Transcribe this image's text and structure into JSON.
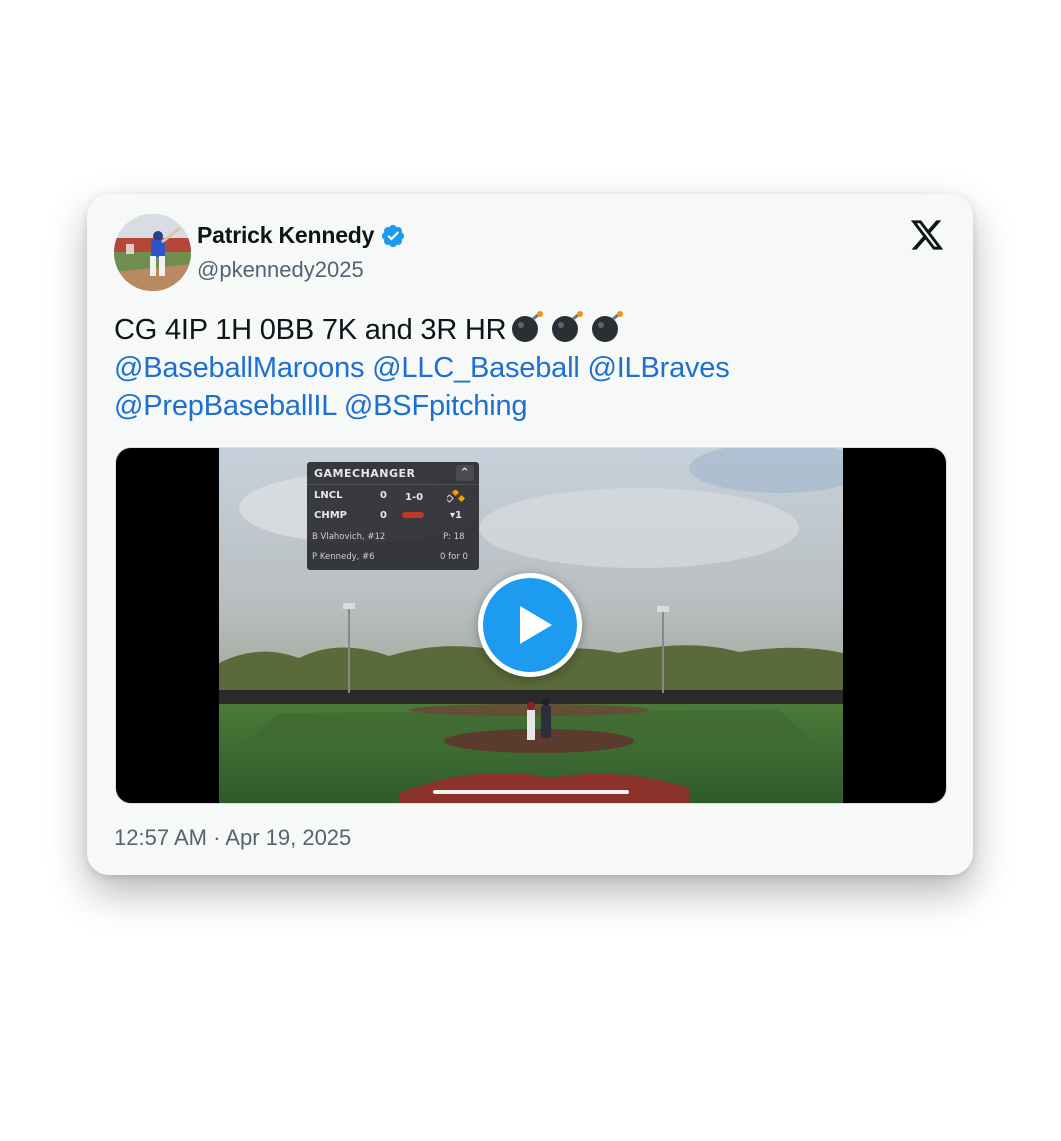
{
  "author": {
    "display_name": "Patrick Kennedy",
    "handle": "@pkennedy2025",
    "verified_icon": "verified-badge-icon"
  },
  "platform_logo": "x-logo-icon",
  "tweet": {
    "text_plain": "CG 4IP 1H 0BB 7K and 3R HR",
    "emoji": [
      "bomb",
      "bomb",
      "bomb"
    ],
    "mentions": [
      "@BaseballMaroons",
      "@LLC_Baseball",
      "@ILBraves",
      "@PrepBaseballIL",
      "@BSFpitching"
    ]
  },
  "media": {
    "type": "video",
    "scoreboard": {
      "brand": "GAMECHANGER",
      "collapse_icon": "^",
      "teams": [
        {
          "abbr": "LNCL",
          "runs": "0"
        },
        {
          "abbr": "CHMP",
          "runs": "0"
        }
      ],
      "count": "1-0",
      "inning": "▾1",
      "pitcher": "B Vlahovich, #12",
      "pitch_count": "P: 18",
      "batter": "P Kennedy, #6",
      "batter_stat": "0 for 0"
    },
    "play_icon": "play-icon"
  },
  "timestamp": "12:57 AM · Apr 19, 2025",
  "colors": {
    "card_bg": "#f7f9f9",
    "text": "#0f1419",
    "secondary": "#536471",
    "link": "#1d6fd1",
    "verified": "#1d9bf0",
    "play": "#1d9bf0"
  }
}
